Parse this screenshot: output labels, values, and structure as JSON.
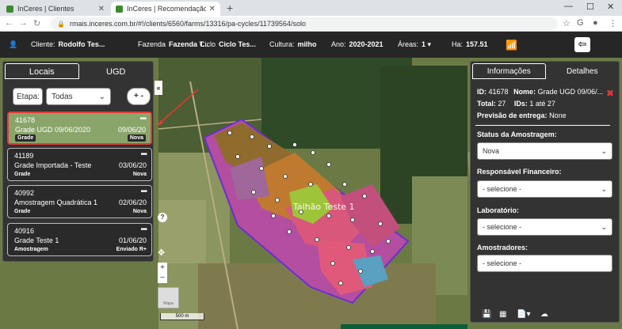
{
  "browser": {
    "tabs": [
      {
        "title": "InCeres | Clientes"
      },
      {
        "title": "InCeres | Recomendação"
      }
    ],
    "url": "rmais.inceres.com.br/#!/clients/6560/farms/13316/pa-cycles/11739564/solo"
  },
  "appbar": {
    "cliente_label": "Cliente:",
    "cliente_value": "Rodolfo Tes...",
    "fazenda_label": "Fazenda",
    "fazenda_value": "Fazenda T...",
    "ciclo_label": "Ciclo",
    "ciclo_value": "Ciclo Tes...",
    "cultura_label": "Cultura:",
    "cultura_value": "milho",
    "ano_label": "Ano:",
    "ano_value": "2020-2021",
    "areas_label": "Áreas:",
    "areas_value": "1",
    "ha_label": "Ha:",
    "ha_value": "157.51"
  },
  "left_panel": {
    "tabs": [
      "Locais",
      "UGD"
    ],
    "etapa_label": "Etapa:",
    "etapa_value": "Todas",
    "add_label": "+ -",
    "cards": [
      {
        "id": "41678",
        "name": "Grade UGD 09/06/2020",
        "date": "09/06/20",
        "type": "Grade",
        "status": "Nova"
      },
      {
        "id": "41189",
        "name": "Grade Importada - Teste",
        "date": "03/06/20",
        "type": "Grade",
        "status": "Nova"
      },
      {
        "id": "40992",
        "name": "Amostragem Quadrática 1",
        "date": "02/06/20",
        "type": "Grade",
        "status": "Nova"
      },
      {
        "id": "40916",
        "name": "Grade Teste 1",
        "date": "01/06/20",
        "type": "Amostragem",
        "status": "Enviado R+"
      }
    ]
  },
  "map": {
    "label": "Talhão Teste 1",
    "scale": "500 m",
    "thumbnail_label": "Mapa"
  },
  "right_panel": {
    "tabs": [
      "Informações",
      "Detalhes"
    ],
    "id_label": "ID:",
    "id_value": "41678",
    "nome_label": "Nome:",
    "nome_value": "Grade UGD 09/06/...",
    "total_label": "Total:",
    "total_value": "27",
    "ids_label": "IDs:",
    "ids_value": "1 até 27",
    "previsao_label": "Previsão de entrega:",
    "previsao_value": "None",
    "status_label": "Status da Amostragem:",
    "status_value": "Nova",
    "responsavel_label": "Responsável Financeiro:",
    "responsavel_value": "- selecione -",
    "laboratorio_label": "Laboratório:",
    "laboratorio_value": "- selecione -",
    "amostradores_label": "Amostradores:",
    "amostradores_value": "- selecione -"
  },
  "colors": {
    "accent_green": "#2ecc40",
    "selected_card_border": "#e53935",
    "selected_card_bg": "#8aa56a"
  }
}
